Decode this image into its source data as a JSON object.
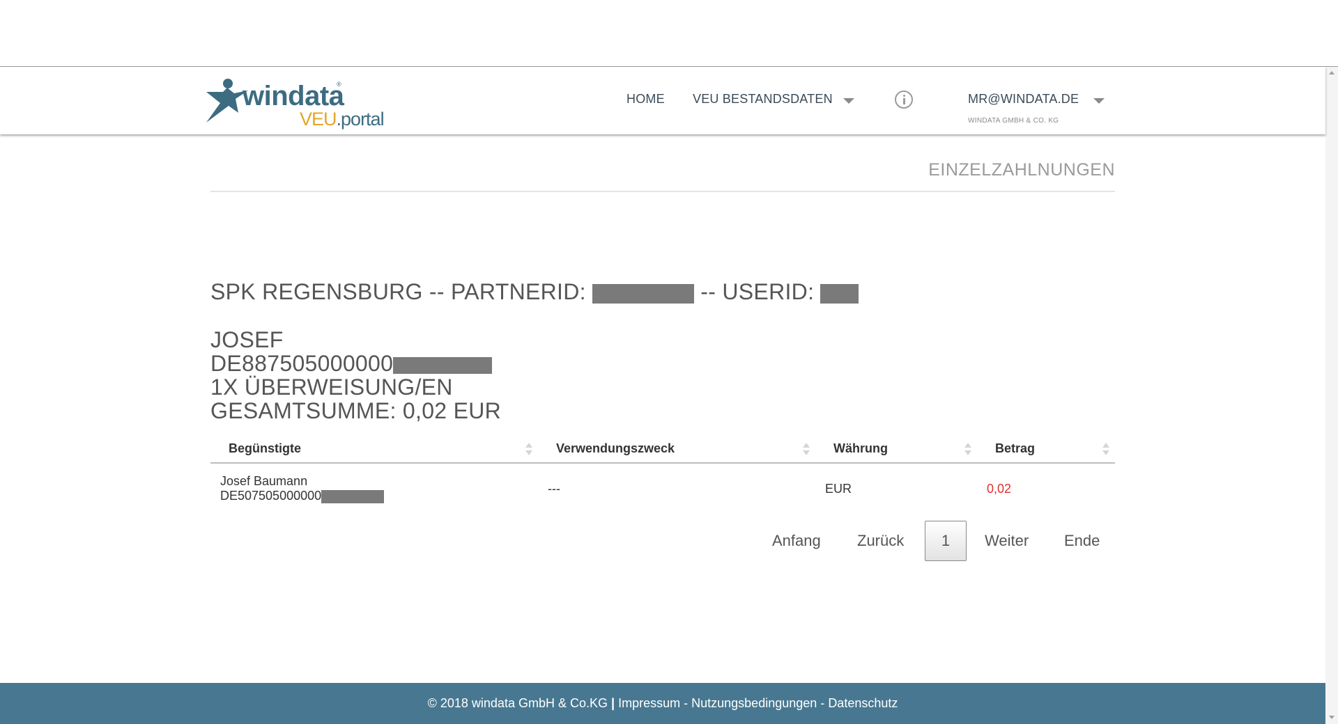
{
  "header": {
    "logo": {
      "brand": "windata",
      "registered": "®",
      "product_prefix": "VEU",
      "product_suffix": ".portal"
    },
    "nav": {
      "home": "HOME",
      "bestandsdaten": "VEU BESTANDSDATEN",
      "user": "MR@WINDATA.DE",
      "company": "WINDATA GMBH & CO. KG"
    }
  },
  "page": {
    "title": "EINZELZAHLNUNGEN",
    "bank_line_prefix": "SPK REGENSBURG -- PARTNERID:",
    "bank_line_mid": "-- USERID:",
    "account_name": "JOSEF",
    "iban_prefix": "DE887505000000",
    "count_line": "1X ÜBERWEISUNG/EN",
    "total_line": "GESAMTSUMME: 0,02 EUR"
  },
  "table": {
    "headers": [
      "Begünstigte",
      "Verwendungszweck",
      "Währung",
      "Betrag"
    ],
    "rows": [
      {
        "name": "Josef Baumann",
        "iban_prefix": "DE507505000000",
        "purpose": "---",
        "currency": "EUR",
        "amount": "0,02"
      }
    ]
  },
  "pagination": {
    "first": "Anfang",
    "prev": "Zurück",
    "current": "1",
    "next": "Weiter",
    "last": "Ende"
  },
  "footer": {
    "copyright": "© 2018 windata GmbH & Co.KG",
    "divider": "|",
    "impressum": "Impressum",
    "dash1": "-",
    "nutzungsbedingungen": "Nutzungsbedingungen",
    "dash2": "-",
    "datenschutz": "Datenschutz"
  },
  "colors": {
    "brand_blue": "#3d6c82",
    "brand_orange": "#e4a52b",
    "footer_bg": "#487891",
    "amount_red": "#e03030"
  }
}
